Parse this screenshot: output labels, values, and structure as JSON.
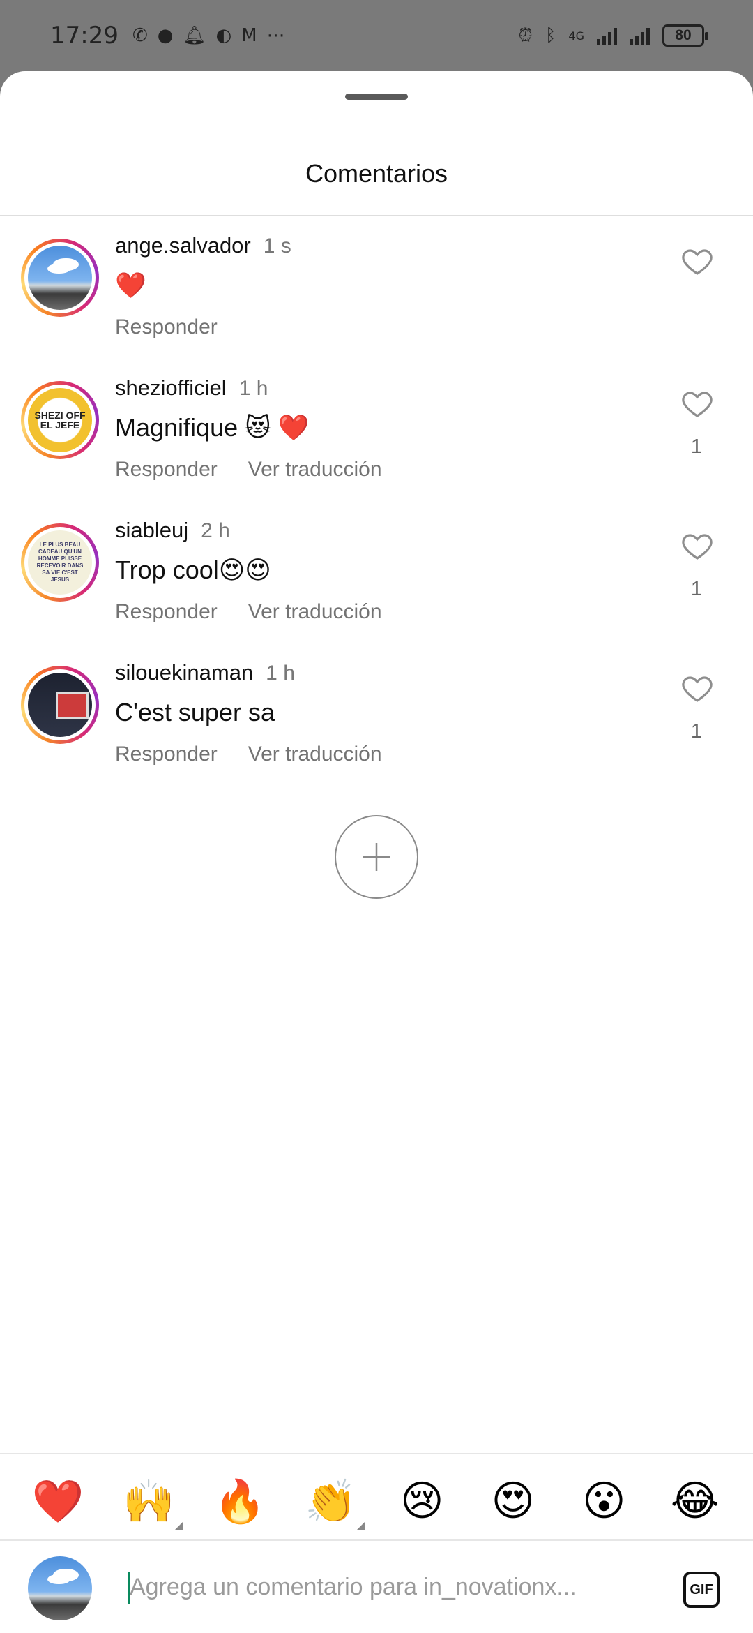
{
  "status_bar": {
    "time": "17:29",
    "left_icons": [
      "missed-call-icon",
      "chat-icon",
      "bell-icon",
      "incognito-icon",
      "gmail-icon",
      "more-icon"
    ],
    "network": "4G",
    "battery": "80"
  },
  "sheet": {
    "title": "Comentarios"
  },
  "comments": [
    {
      "username": "ange.salvador",
      "time": "1 s",
      "text": "❤️",
      "reply_label": "Responder",
      "translate_label": "",
      "likes": ""
    },
    {
      "username": "sheziofficiel",
      "time": "1 h",
      "text": "Magnifique 😻 ❤️",
      "reply_label": "Responder",
      "translate_label": "Ver traducción",
      "likes": "1"
    },
    {
      "username": "siableuj",
      "time": "2 h",
      "text": "Trop cool😍😍",
      "reply_label": "Responder",
      "translate_label": "Ver traducción",
      "likes": "1"
    },
    {
      "username": "silouekinaman",
      "time": "1 h",
      "text": "C'est super sa",
      "reply_label": "Responder",
      "translate_label": "Ver traducción",
      "likes": "1"
    }
  ],
  "avatar_text": {
    "shezi": "SHEZI OFF EL JEFE",
    "siableuj": "LE PLUS BEAU CADEAU QU'UN HOMME PUISSE RECEVOIR DANS SA VIE C'EST JESUS"
  },
  "quick_emojis": [
    "❤️",
    "🙌",
    "🔥",
    "👏",
    "😢",
    "😍",
    "😮",
    "😂"
  ],
  "composer": {
    "placeholder": "Agrega un comentario para in_novationx...",
    "gif_label": "GIF"
  },
  "colors": {
    "accent_ring": "#d62976",
    "caret": "#0a8a5e"
  }
}
